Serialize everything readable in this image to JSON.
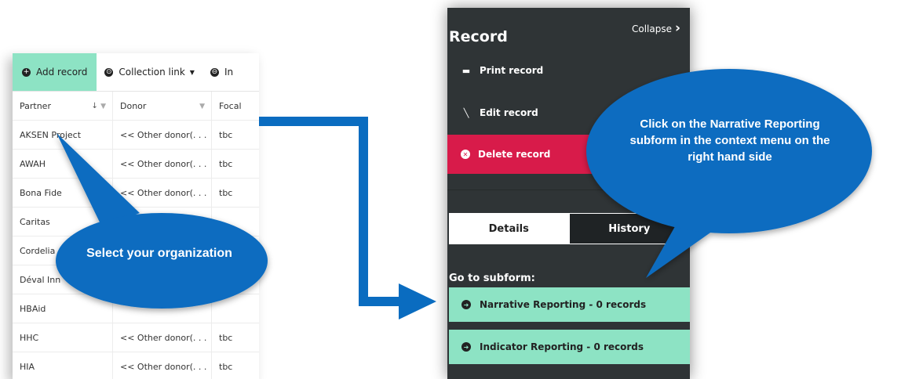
{
  "table": {
    "toolbar": {
      "add_label": "Add record",
      "collection_label": "Collection link",
      "third_label": "In"
    },
    "headers": [
      "Partner",
      "Donor",
      "Focal"
    ],
    "rows": [
      {
        "partner": "AKSEN Project",
        "donor": "<< Other donor(. . .",
        "focal": "tbc"
      },
      {
        "partner": "AWAH",
        "donor": "<< Other donor(. . .",
        "focal": "tbc"
      },
      {
        "partner": "Bona Fide",
        "donor": "<< Other donor(. . .",
        "focal": "tbc"
      },
      {
        "partner": "Caritas",
        "donor": "",
        "focal": ""
      },
      {
        "partner": "Cordelia",
        "donor": "",
        "focal": ""
      },
      {
        "partner": "Déval Inn",
        "donor": "",
        "focal": ""
      },
      {
        "partner": "HBAid",
        "donor": "",
        "focal": ""
      },
      {
        "partner": "HHC",
        "donor": "<< Other donor(. . .",
        "focal": "tbc"
      },
      {
        "partner": "HIA",
        "donor": "<< Other donor(. . .",
        "focal": "tbc"
      }
    ]
  },
  "record": {
    "title": "Record",
    "collapse_label": "Collapse",
    "print_label": "Print record",
    "edit_label": "Edit record",
    "delete_label": "Delete record",
    "tab_details": "Details",
    "tab_history": "History",
    "subform_heading": "Go to subform:",
    "subforms": [
      "Narrative Reporting - 0 records",
      "Indicator Reporting - 0 records"
    ]
  },
  "callouts": {
    "left": "Select your organization",
    "right": "Click on the Narrative Reporting subform in the context menu on the right hand side"
  },
  "colors": {
    "accent_green": "#8de3c4",
    "panel_dark": "#2f3436",
    "delete_red": "#d81b4a",
    "callout_blue": "#0a6cc0"
  },
  "icons": [
    "plus-circle-icon",
    "link-circle-icon",
    "sort-down-icon",
    "filter-icon",
    "print-icon",
    "edit-icon",
    "delete-circle-icon",
    "chevron-right-icon",
    "arrow-circle-icon"
  ]
}
